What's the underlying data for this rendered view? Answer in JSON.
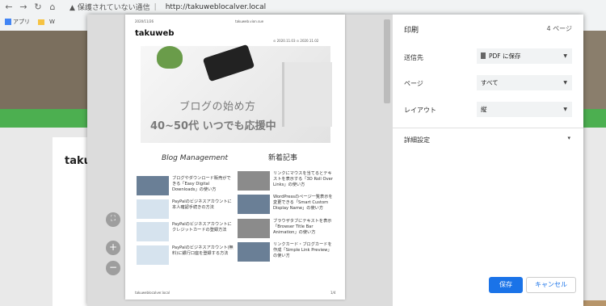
{
  "browser": {
    "security_text": "保護されていない通信",
    "url": "http://takuweblocalver.local",
    "bookmarks_label": "アプリ",
    "wp_label": "W"
  },
  "background": {
    "site_title": "taku"
  },
  "preview": {
    "date_top": "2020/11/26",
    "site_url_top": "takuweb.vion.sue",
    "site_title": "takuweb",
    "post_dates": "⊙ 2020.11.03   ⊙ 2020.11.02",
    "hero_line1": "ブログの始め方",
    "hero_line2": "40~50代 いつでも応援中",
    "left_heading": "Blog Management",
    "right_heading": "新着記事",
    "left_items": [
      "ブログやダウンロード販売ができる「Easy Digital Downloads」の使い方",
      "PayPalのビジネスアカウントに本人確認手続きの方法",
      "PayPalのビジネスアカウントにクレジットカードの登録方法",
      "PayPalのビジネスアカウント(無料)に銀行口座を登録する方法"
    ],
    "right_items": [
      "リンクにマウスを当てるとテキストを表示する「3D Roll Over Links」の使い方",
      "WordPressのページ一覧表示を変更できる「Smart Custom Display Name」の使い方",
      "ブラウザタブにテキストを表示「Browser Title Bar Animation」の使い方",
      "リンクカード・ブログカードを作成「Simple Link Preview」の使い方"
    ],
    "footer_url": "takuweblocalver.local",
    "footer_page": "1/4"
  },
  "settings": {
    "title": "印刷",
    "page_count": "4 ページ",
    "destination_label": "送信先",
    "destination_value": "PDF に保存",
    "pages_label": "ページ",
    "pages_value": "すべて",
    "layout_label": "レイアウト",
    "layout_value": "縦",
    "more_label": "詳細設定",
    "save_label": "保存",
    "cancel_label": "キャンセル"
  },
  "zoom": {
    "fit": "⛶",
    "plus": "+",
    "minus": "−"
  },
  "colors": {
    "accent": "#1a73e8",
    "green_bar": "#4caf50"
  }
}
